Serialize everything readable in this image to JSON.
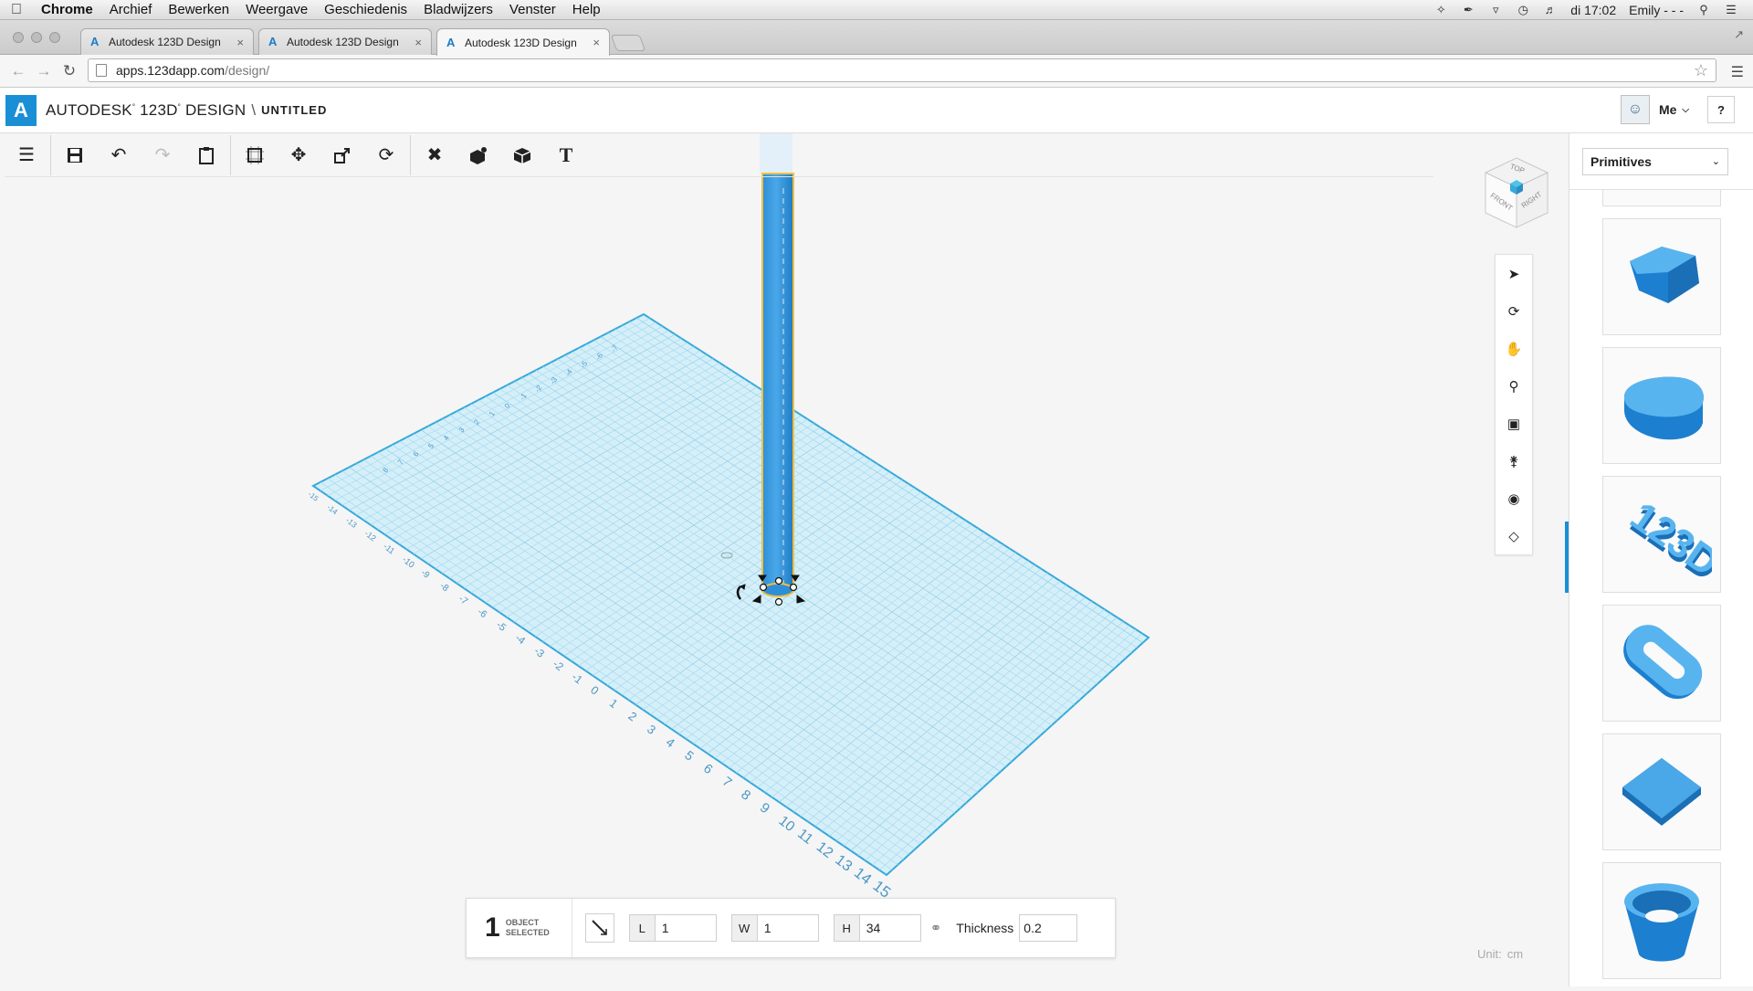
{
  "menubar": {
    "items": [
      "Chrome",
      "Archief",
      "Bewerken",
      "Weergave",
      "Geschiedenis",
      "Bladwijzers",
      "Venster",
      "Help"
    ],
    "clock": "di 17:02",
    "user": "Emily - - -"
  },
  "tabs": [
    {
      "title": "Autodesk 123D Design"
    },
    {
      "title": "Autodesk 123D Design"
    },
    {
      "title": "Autodesk 123D Design"
    }
  ],
  "address": {
    "host": "apps.123dapp.com",
    "path": "/design/"
  },
  "app": {
    "brand_prefix": "AUTODESK",
    "brand_name": "123D",
    "brand_suffix": "DESIGN",
    "separator": "\\",
    "document_title": "UNTITLED",
    "user_label": "Me",
    "help_label": "?"
  },
  "viewcube": {
    "top": "TOP",
    "front": "FRONT",
    "right": "RIGHT"
  },
  "grid": {
    "left_labels": [
      "-15",
      "-14",
      "-13",
      "-12",
      "-11",
      "-10",
      "-9",
      "-8",
      "-7",
      "-6",
      "-5",
      "-4",
      "-3",
      "-2",
      "-1",
      "0",
      "1",
      "2",
      "3",
      "4",
      "5",
      "6",
      "7",
      "8",
      "9",
      "10",
      "11",
      "12",
      "13",
      "14",
      "15"
    ],
    "top_labels": [
      "8",
      "7",
      "6",
      "5",
      "4",
      "3",
      "2",
      "1",
      "0",
      "-1",
      "-2",
      "-3",
      "-4",
      "-5",
      "-6",
      "-7"
    ]
  },
  "properties": {
    "selected_count": "1",
    "selected_label_1": "OBJECT",
    "selected_label_2": "SELECTED",
    "length_key": "L",
    "length_value": "1",
    "width_key": "W",
    "width_value": "1",
    "height_key": "H",
    "height_value": "34",
    "thickness_label": "Thickness",
    "thickness_value": "0.2"
  },
  "unit": {
    "label": "Unit:",
    "value": "cm"
  },
  "panel": {
    "dropdown_label": "Primitives"
  },
  "colors": {
    "accent": "#1b8fd6",
    "grid": "#cfeaf7",
    "shape": "#2b8fd8"
  }
}
